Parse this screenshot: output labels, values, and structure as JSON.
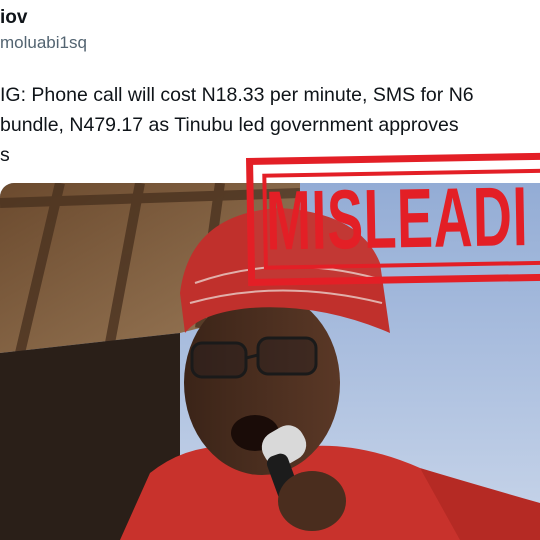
{
  "post": {
    "author_name_fragment": "iov",
    "author_handle_fragment": "moluabi1sq",
    "text_lines": [
      "IG: Phone call will cost N18.33 per minute, SMS for N6",
      " bundle, N479.17 as Tinubu led government approves",
      "s"
    ]
  },
  "stamp": {
    "label": "MISLEADI",
    "color": "#e31f26"
  },
  "image": {
    "icon": "photo-of-man-speaking-into-microphone"
  }
}
